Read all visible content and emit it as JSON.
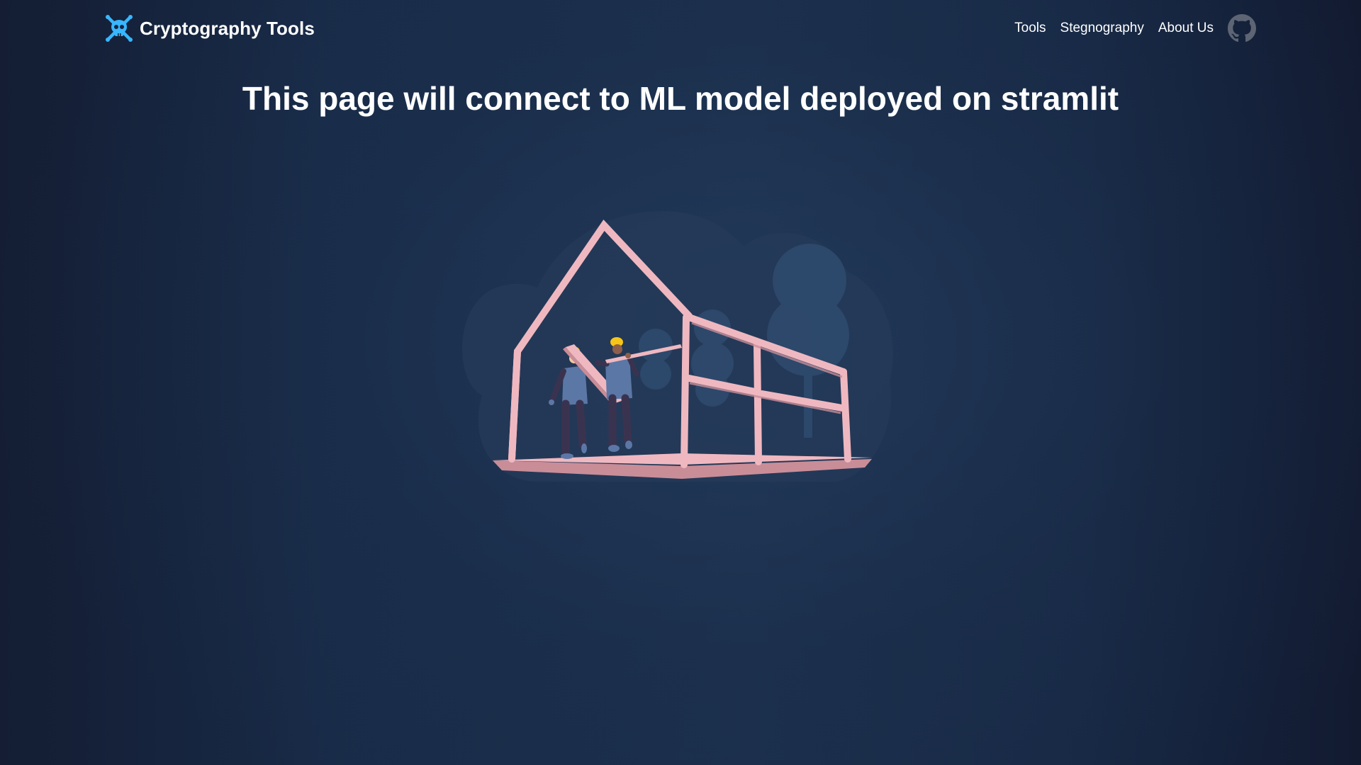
{
  "navbar": {
    "brand": {
      "logo_icon": "skull-crossbones-icon",
      "title": "Cryptography Tools",
      "accent_color": "#38b6ff"
    },
    "links": [
      {
        "label": "Tools"
      },
      {
        "label": "Stegnography"
      },
      {
        "label": "About Us"
      }
    ],
    "github_icon": "github-icon"
  },
  "main": {
    "heading": "This page will connect to ML model deployed on stramlit",
    "illustration": "under-construction-house-frame-with-workers"
  },
  "colors": {
    "background_dark": "#121a30",
    "background_mid": "#1b2f4c",
    "frame_pink": "#efb8c0",
    "helmet_yellow": "#f5c518",
    "text": "#ffffff"
  }
}
